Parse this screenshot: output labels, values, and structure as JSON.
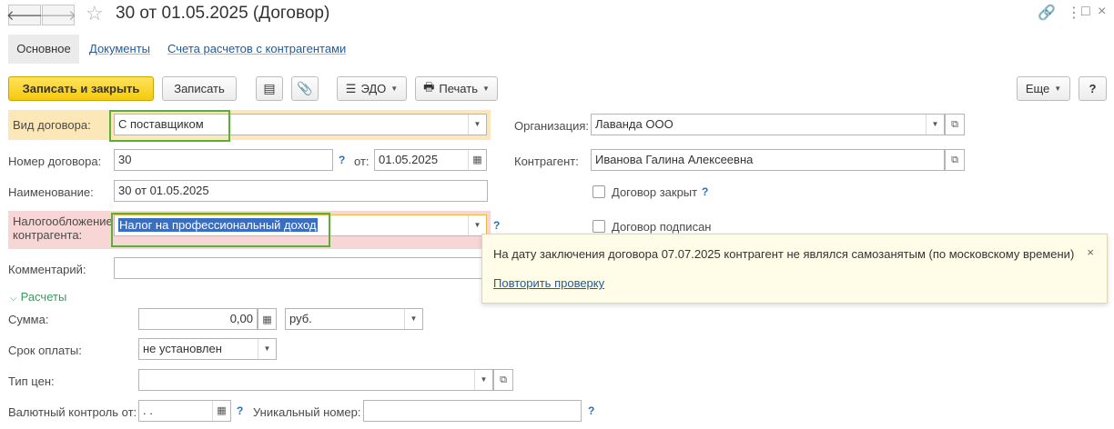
{
  "window": {
    "title": "30 от 01.05.2025 (Договор)"
  },
  "tabs": [
    {
      "label": "Основное"
    },
    {
      "label": "Документы"
    },
    {
      "label": "Счета расчетов с контрагентами"
    }
  ],
  "toolbar": {
    "save_close": "Записать и закрыть",
    "save": "Записать",
    "edo": "ЭДО",
    "print": "Печать",
    "more": "Еще",
    "help": "?"
  },
  "form": {
    "contract_type": {
      "label": "Вид договора:",
      "value": "С поставщиком"
    },
    "contract_number": {
      "label": "Номер договора:",
      "value": "30",
      "date_label": "от:",
      "date_value": "01.05.2025"
    },
    "name": {
      "label": "Наименование:",
      "value": "30 от 01.05.2025"
    },
    "taxation": {
      "label_line1": "Налогообложение",
      "label_line2": "контрагента:",
      "value": "Налог на профессиональный доход"
    },
    "comment": {
      "label": "Комментарий:",
      "value": ""
    },
    "organization": {
      "label": "Организация:",
      "value": "Лаванда ООО"
    },
    "counterparty": {
      "label": "Контрагент:",
      "value": "Иванова Галина Алексеевна"
    },
    "contract_closed": {
      "label": "Договор закрыт",
      "checked": false
    },
    "contract_signed": {
      "label": "Договор подписан",
      "checked": false
    }
  },
  "settlements": {
    "section_label": "Расчеты",
    "amount": {
      "label": "Сумма:",
      "value": "0,00",
      "currency": "руб."
    },
    "payment_term": {
      "label": "Срок оплаты:",
      "value": "не установлен"
    },
    "price_type": {
      "label": "Тип цен:",
      "value": ""
    },
    "currency_control": {
      "label": "Валютный контроль от:",
      "value": " .  .",
      "unique_label": "Уникальный номер:",
      "unique_value": ""
    }
  },
  "popup": {
    "message": "На дату заключения договора 07.07.2025 контрагент не являлся самозанятым (по московскому времени)",
    "link": "Повторить проверку",
    "close": "×"
  },
  "colors": {
    "primary_button": "#f5c90e",
    "highlight_yellow": "#fbe7b8",
    "highlight_red": "#f8d6d6",
    "green_frame": "#5ab033",
    "link": "#1e5a9e",
    "selection": "#3a6ec0"
  }
}
